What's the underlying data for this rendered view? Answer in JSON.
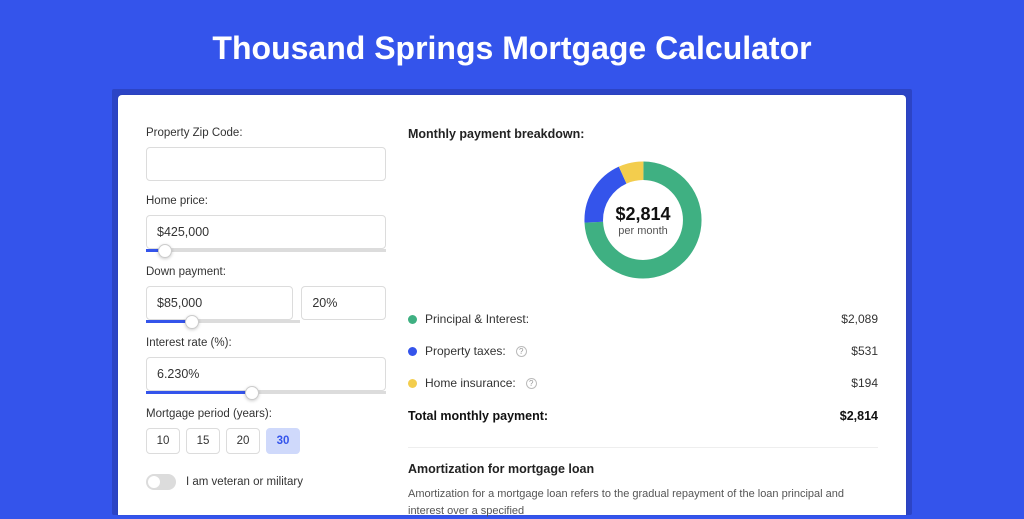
{
  "title": "Thousand Springs Mortgage Calculator",
  "form": {
    "zip_label": "Property Zip Code:",
    "zip_value": "",
    "home_price_label": "Home price:",
    "home_price_value": "$425,000",
    "home_price_slider_pct": 8,
    "down_payment_label": "Down payment:",
    "down_payment_value": "$85,000",
    "down_payment_pct_value": "20%",
    "down_payment_slider_pct": 30,
    "interest_label": "Interest rate (%):",
    "interest_value": "6.230%",
    "interest_slider_pct": 44,
    "period_label": "Mortgage period (years):",
    "periods": [
      "10",
      "15",
      "20",
      "30"
    ],
    "period_active_index": 3,
    "veteran_label": "I am veteran or military",
    "veteran_on": false
  },
  "breakdown": {
    "heading": "Monthly payment breakdown:",
    "total_value": "$2,814",
    "total_sub": "per month",
    "items": [
      {
        "label": "Principal & Interest:",
        "value": "$2,089",
        "color": "g",
        "pct": 74.2,
        "info": false
      },
      {
        "label": "Property taxes:",
        "value": "$531",
        "color": "b",
        "pct": 18.9,
        "info": true
      },
      {
        "label": "Home insurance:",
        "value": "$194",
        "color": "y",
        "pct": 6.9,
        "info": true
      }
    ],
    "total_label": "Total monthly payment:",
    "total_amount": "$2,814"
  },
  "amortization": {
    "title": "Amortization for mortgage loan",
    "text": "Amortization for a mortgage loan refers to the gradual repayment of the loan principal and interest over a specified"
  },
  "chart_data": {
    "type": "pie",
    "title": "Monthly payment breakdown",
    "series": [
      {
        "name": "Principal & Interest",
        "value": 2089,
        "color": "#3fb082"
      },
      {
        "name": "Property taxes",
        "value": 531,
        "color": "#3454eb"
      },
      {
        "name": "Home insurance",
        "value": 194,
        "color": "#f3cd4d"
      }
    ],
    "total": 2814,
    "total_label": "per month"
  }
}
